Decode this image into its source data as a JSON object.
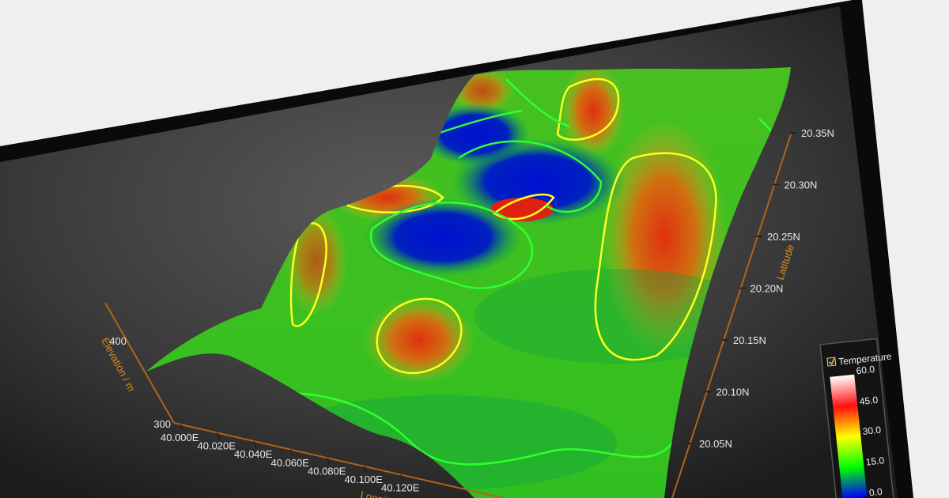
{
  "chart_data": {
    "type": "surface",
    "title": "",
    "x_axis": {
      "label": "Longitude",
      "ticks": [
        "40.000E",
        "40.020E",
        "40.040E",
        "40.060E",
        "40.080E",
        "40.100E",
        "40.120E"
      ],
      "range": [
        40.0,
        40.13
      ]
    },
    "y_axis": {
      "label": "Latitude",
      "ticks": [
        "20.05N",
        "20.10N",
        "20.15N",
        "20.20N",
        "20.25N",
        "20.30N",
        "20.35N"
      ],
      "range": [
        20.03,
        20.36
      ]
    },
    "z_axis": {
      "label": "Elevation / m",
      "ticks": [
        "300",
        "400"
      ],
      "range": [
        300,
        450
      ]
    },
    "color_scale": {
      "title": "Temperature",
      "checked": true,
      "ticks": [
        "60.0",
        "45.0",
        "30.0",
        "15.0",
        "0.0"
      ],
      "range": [
        0,
        60
      ],
      "stops": [
        {
          "value": 0,
          "color": "#0000ff"
        },
        {
          "value": 15,
          "color": "#00ff00"
        },
        {
          "value": 30,
          "color": "#ffff00"
        },
        {
          "value": 45,
          "color": "#ff0000"
        },
        {
          "value": 60,
          "color": "#ffffff"
        }
      ]
    },
    "contour_levels": [
      15,
      30,
      45
    ],
    "grid": false,
    "legend_position": "bottom-right"
  }
}
